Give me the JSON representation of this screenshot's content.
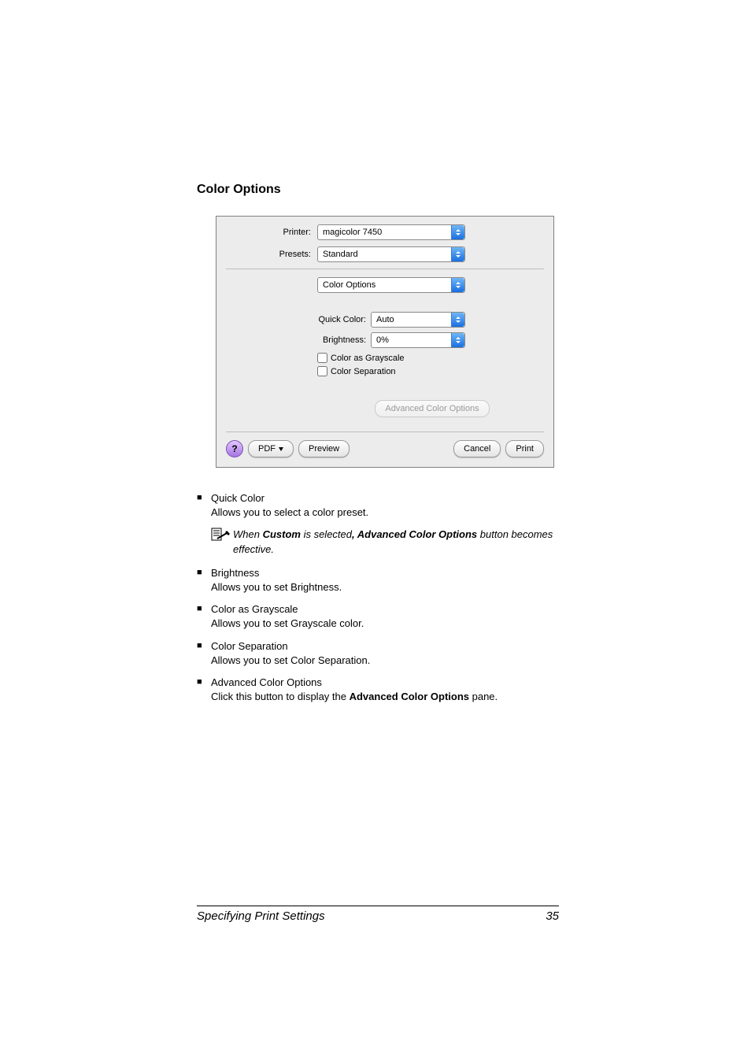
{
  "section": {
    "title": "Color Options"
  },
  "dialog": {
    "printer_label": "Printer:",
    "printer_value": "magicolor 7450",
    "presets_label": "Presets:",
    "presets_value": "Standard",
    "pane_value": "Color Options",
    "quick_color_label": "Quick Color:",
    "quick_color_value": "Auto",
    "brightness_label": "Brightness:",
    "brightness_value": "0%",
    "grayscale_label": "Color as Grayscale",
    "separation_label": "Color Separation",
    "advanced_btn": "Advanced Color Options",
    "help_glyph": "?",
    "pdf_btn": "PDF ",
    "preview_btn": "Preview",
    "cancel_btn": "Cancel",
    "print_btn": "Print"
  },
  "bullets": {
    "quick_color": {
      "title": "Quick Color",
      "desc": "Allows you to select a color preset."
    },
    "note": {
      "prefix": "When ",
      "custom": "Custom",
      "mid": " is selected",
      "bold": ", Advanced Color Options",
      "suffix": " button becomes effective."
    },
    "brightness": {
      "title": "Brightness",
      "desc": "Allows you to set Brightness."
    },
    "grayscale": {
      "title": "Color as Grayscale",
      "desc": "Allows you to set Grayscale color."
    },
    "separation": {
      "title": "Color Separation",
      "desc": "Allows you to set Color Separation."
    },
    "advanced": {
      "title": "Advanced Color Options",
      "pre": "Click this button to display the ",
      "bold": "Advanced Color Options",
      "post": " pane."
    }
  },
  "footer": {
    "title": "Specifying Print Settings",
    "page": "35"
  }
}
